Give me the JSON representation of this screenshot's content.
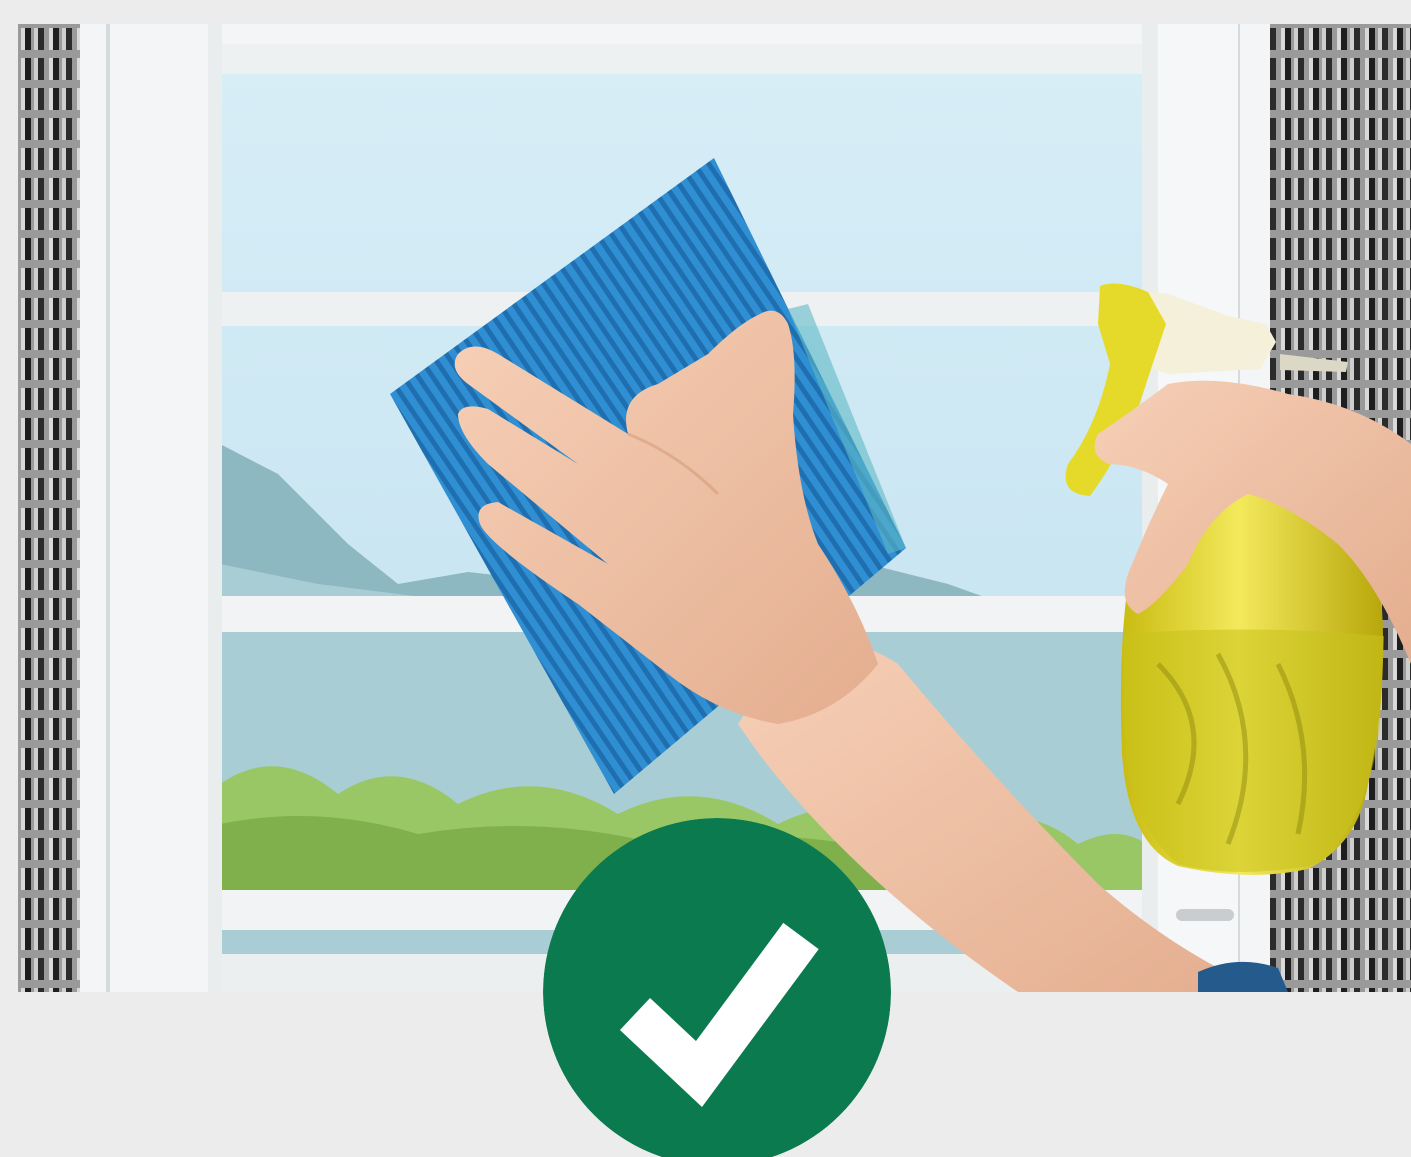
{
  "photo": {
    "subject": "hand-wiping-window-with-cloth-and-spray-bottle",
    "colors": {
      "background": "#ececec",
      "cloth": "#2e8fd0",
      "bottle": "#e8dc3a",
      "sky": "#cfe7f2",
      "mountain": "#8cb7bf",
      "greenery": "#9cc86a",
      "frame": "#f4f6f7",
      "grille": "#2a2a2a",
      "skin": "#f0c4a8"
    }
  },
  "badge": {
    "icon": "checkmark-icon",
    "colors": {
      "fill": "#0b7a4f",
      "mark": "#ffffff"
    }
  }
}
